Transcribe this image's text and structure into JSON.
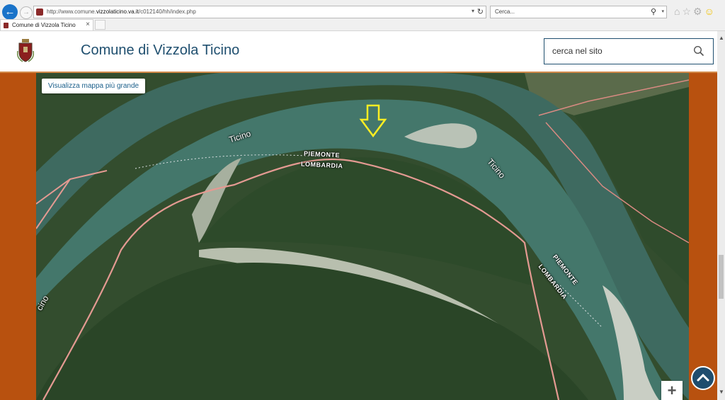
{
  "browser": {
    "address": {
      "url_prefix": "http://www.comune.",
      "url_domain": "vizzolaticino.va.it",
      "url_suffix": "/c012140/hh/index.php"
    },
    "search_placeholder": "Cerca...",
    "tab_title": "Comune di Vizzola Ticino"
  },
  "site": {
    "title": "Comune di Vizzola Ticino",
    "search_placeholder": "cerca nel sito"
  },
  "map": {
    "larger_map_button": "Visualizza mappa più grande",
    "river_labels": [
      "Ticino",
      "Ticino",
      "cino"
    ],
    "region_labels": {
      "upper_north": "PIEMONTE",
      "upper_south": "LOMBARDIA",
      "lower_north": "PIEMONTE",
      "lower_south": "LOMBARDIA"
    },
    "zoom_in": "+"
  },
  "colors": {
    "page_background": "#b8510f",
    "header_title": "#1f4f6f",
    "border_line": "#e49a92",
    "arrow": "#ffee22"
  }
}
